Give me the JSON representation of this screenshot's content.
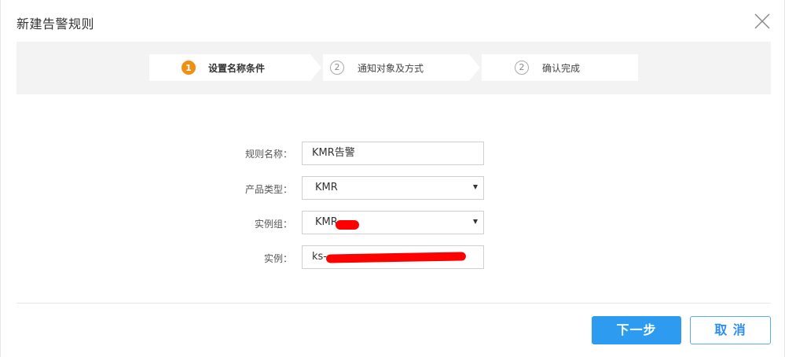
{
  "dialog": {
    "title": "新建告警规则"
  },
  "steps": [
    {
      "number": "1",
      "label": "设置名称条件",
      "active": true
    },
    {
      "number": "2",
      "label": "通知对象及方式",
      "active": false
    },
    {
      "number": "2",
      "label": "确认完成",
      "active": false
    }
  ],
  "form": {
    "rule_name": {
      "label": "规则名称：",
      "value": "KMR告警"
    },
    "product_type": {
      "label": "产品类型：",
      "value": "KMR"
    },
    "instance_group": {
      "label": "实例组：",
      "value": "KMR"
    },
    "instance": {
      "label": "实例：",
      "value": "ks-"
    }
  },
  "buttons": {
    "next": "下一步",
    "cancel": "取 消"
  },
  "colors": {
    "accent": "#2d9cf0",
    "step_active": "#f08f12",
    "redaction": "#ff0000"
  }
}
